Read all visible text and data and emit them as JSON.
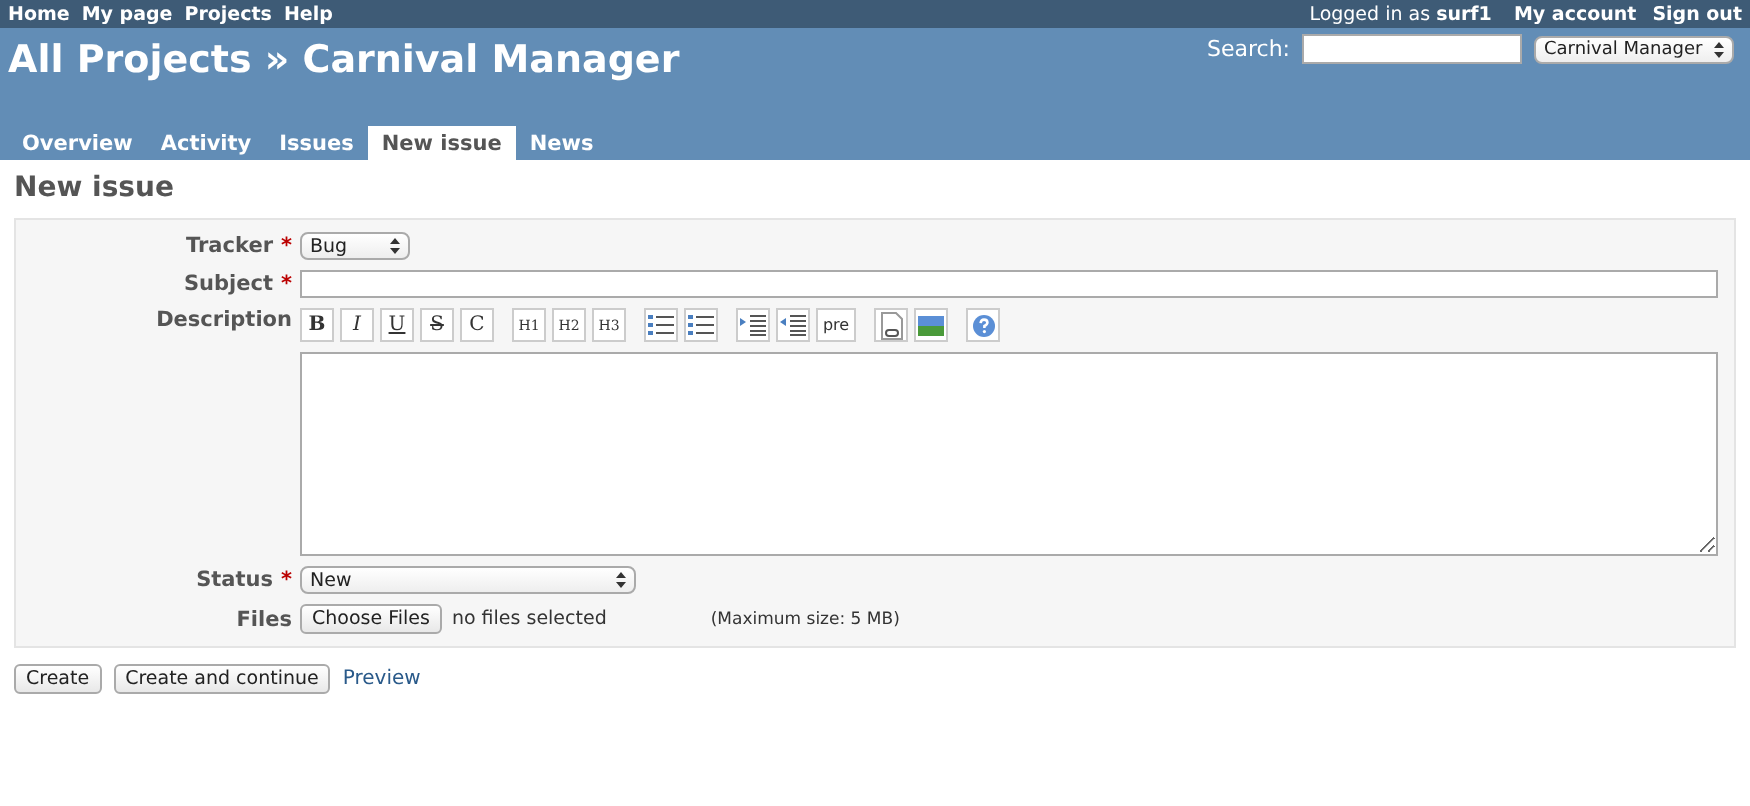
{
  "top_menu": {
    "left": [
      "Home",
      "My page",
      "Projects",
      "Help"
    ],
    "logged_in_prefix": "Logged in as",
    "user": "surf1",
    "right": [
      "My account",
      "Sign out"
    ]
  },
  "header": {
    "title": "All Projects » Carnival Manager",
    "search_label": "Search:",
    "project_select": "Carnival Manager"
  },
  "tabs": [
    {
      "label": "Overview",
      "selected": false
    },
    {
      "label": "Activity",
      "selected": false
    },
    {
      "label": "Issues",
      "selected": false
    },
    {
      "label": "New issue",
      "selected": true
    },
    {
      "label": "News",
      "selected": false
    }
  ],
  "page_title": "New issue",
  "form": {
    "tracker": {
      "label": "Tracker",
      "required_mark": "*",
      "value": "Bug"
    },
    "subject": {
      "label": "Subject",
      "required_mark": "*"
    },
    "description": {
      "label": "Description",
      "toolbar": [
        [
          {
            "kind": "text",
            "label": "B"
          },
          {
            "kind": "text",
            "label": "I"
          },
          {
            "kind": "text",
            "label": "U"
          },
          {
            "kind": "text",
            "label": "S"
          },
          {
            "kind": "text",
            "label": "C"
          }
        ],
        [
          {
            "kind": "text",
            "label": "H1"
          },
          {
            "kind": "text",
            "label": "H2"
          },
          {
            "kind": "text",
            "label": "H3"
          }
        ],
        [
          {
            "kind": "bullets"
          },
          {
            "kind": "numbers"
          }
        ],
        [
          {
            "kind": "indent"
          },
          {
            "kind": "outdent"
          },
          {
            "kind": "text",
            "label": "pre"
          }
        ],
        [
          {
            "kind": "file"
          },
          {
            "kind": "image"
          }
        ],
        [
          {
            "kind": "help"
          }
        ]
      ]
    },
    "status": {
      "label": "Status",
      "required_mark": "*",
      "value": "New"
    },
    "files": {
      "label": "Files",
      "button": "Choose Files",
      "status": "no files selected",
      "note": "(Maximum size: 5 MB)"
    }
  },
  "actions": {
    "buttons": [
      "Create",
      "Create and continue"
    ],
    "link": "Preview"
  }
}
